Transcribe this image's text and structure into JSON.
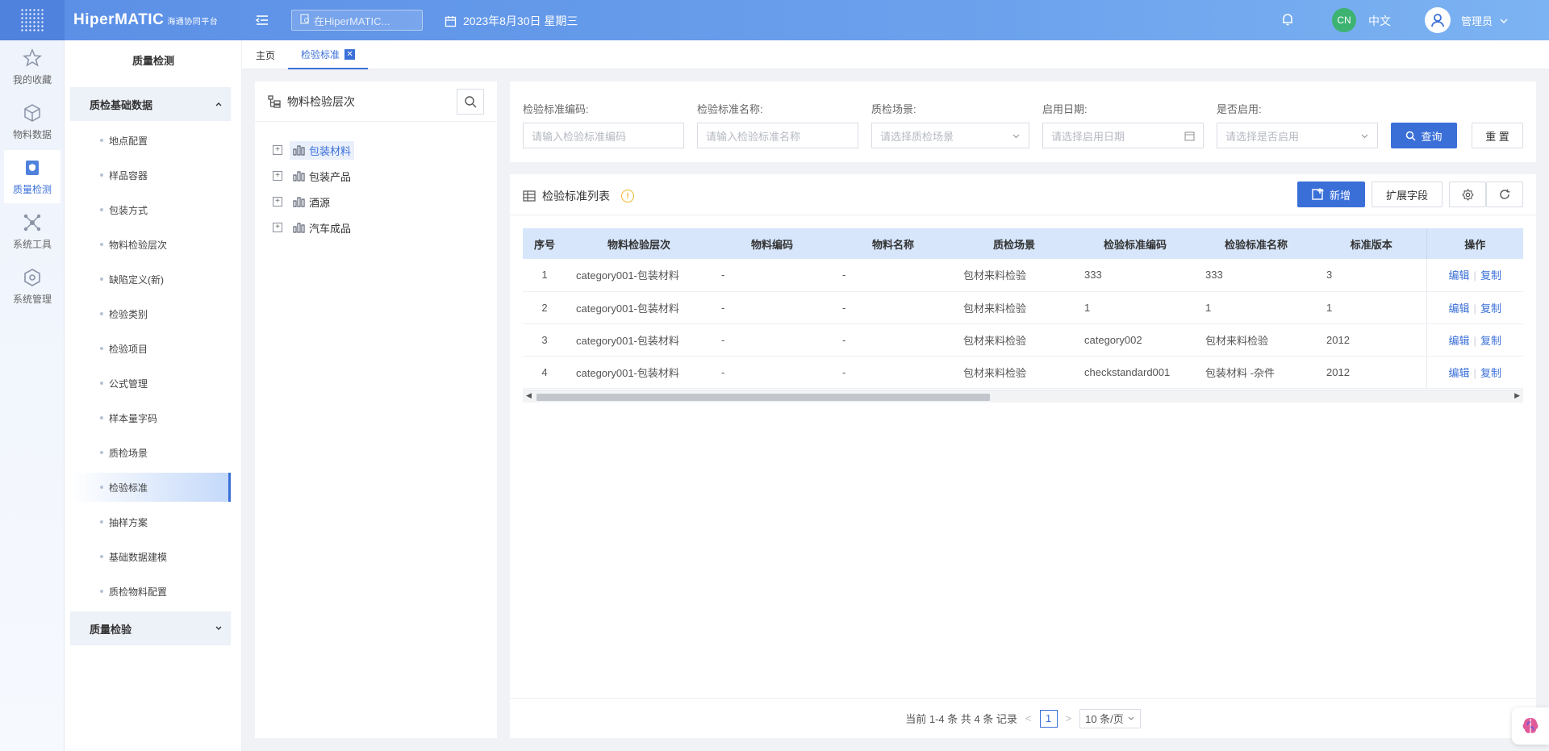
{
  "header": {
    "logo": "HiperMATIC",
    "logo_sub": "海通协同平台",
    "search_placeholder": "在HiperMATIC...",
    "date": "2023年8月30日 星期三",
    "lang_badge": "CN",
    "lang_label": "中文",
    "username": "管理员"
  },
  "rail": [
    {
      "label": "我的收藏",
      "icon": "star-icon"
    },
    {
      "label": "物料数据",
      "icon": "cube-icon"
    },
    {
      "label": "质量检测",
      "icon": "shield-doc-icon"
    },
    {
      "label": "系统工具",
      "icon": "network-icon"
    },
    {
      "label": "系统管理",
      "icon": "hexagon-icon"
    }
  ],
  "submenu": {
    "title": "质量检测",
    "group1": "质检基础数据",
    "items": [
      "地点配置",
      "样品容器",
      "包装方式",
      "物料检验层次",
      "缺陷定义(新)",
      "检验类别",
      "检验项目",
      "公式管理",
      "样本量字码",
      "质检场景",
      "检验标准",
      "抽样方案",
      "基础数据建模",
      "质检物料配置"
    ],
    "group2": "质量检验"
  },
  "tabs": {
    "home": "主页",
    "active": "检验标准"
  },
  "tree": {
    "title": "物料检验层次",
    "nodes": [
      "包装材料",
      "包装产品",
      "酒源",
      "汽车成品"
    ]
  },
  "filters": {
    "code_label": "检验标准编码:",
    "code_placeholder": "请输入检验标准编码",
    "name_label": "检验标准名称:",
    "name_placeholder": "请输入检验标准名称",
    "scene_label": "质检场景:",
    "scene_placeholder": "请选择质检场景",
    "date_label": "启用日期:",
    "date_placeholder": "请选择启用日期",
    "enabled_label": "是否启用:",
    "enabled_placeholder": "请选择是否启用",
    "query": "查询",
    "reset": "重 置"
  },
  "list": {
    "title": "检验标准列表",
    "add": "新增",
    "extend": "扩展字段",
    "columns": [
      "序号",
      "物料检验层次",
      "物料编码",
      "物料名称",
      "质检场景",
      "检验标准编码",
      "检验标准名称",
      "标准版本",
      "操作"
    ],
    "rows": [
      {
        "no": "1",
        "level": "category001-包装材料",
        "mcode": "-",
        "mname": "-",
        "scene": "包材来料检验",
        "code": "333",
        "name": "333",
        "ver": "3"
      },
      {
        "no": "2",
        "level": "category001-包装材料",
        "mcode": "-",
        "mname": "-",
        "scene": "包材来料检验",
        "code": "1",
        "name": "1",
        "ver": "1"
      },
      {
        "no": "3",
        "level": "category001-包装材料",
        "mcode": "-",
        "mname": "-",
        "scene": "包材来料检验",
        "code": "category002",
        "name": "包材来料检验",
        "ver": "2012"
      },
      {
        "no": "4",
        "level": "category001-包装材料",
        "mcode": "-",
        "mname": "-",
        "scene": "包材来料检验",
        "code": "checkstandard001",
        "name": "包装材料 -杂件",
        "ver": "2012"
      }
    ],
    "edit": "编辑",
    "copy": "复制"
  },
  "pager": {
    "summary": "当前 1-4 条 共 4 条 记录",
    "page": "1",
    "size": "10 条/页"
  },
  "colors": {
    "primary": "#3a6fd8",
    "header": "#5b8fe6"
  }
}
